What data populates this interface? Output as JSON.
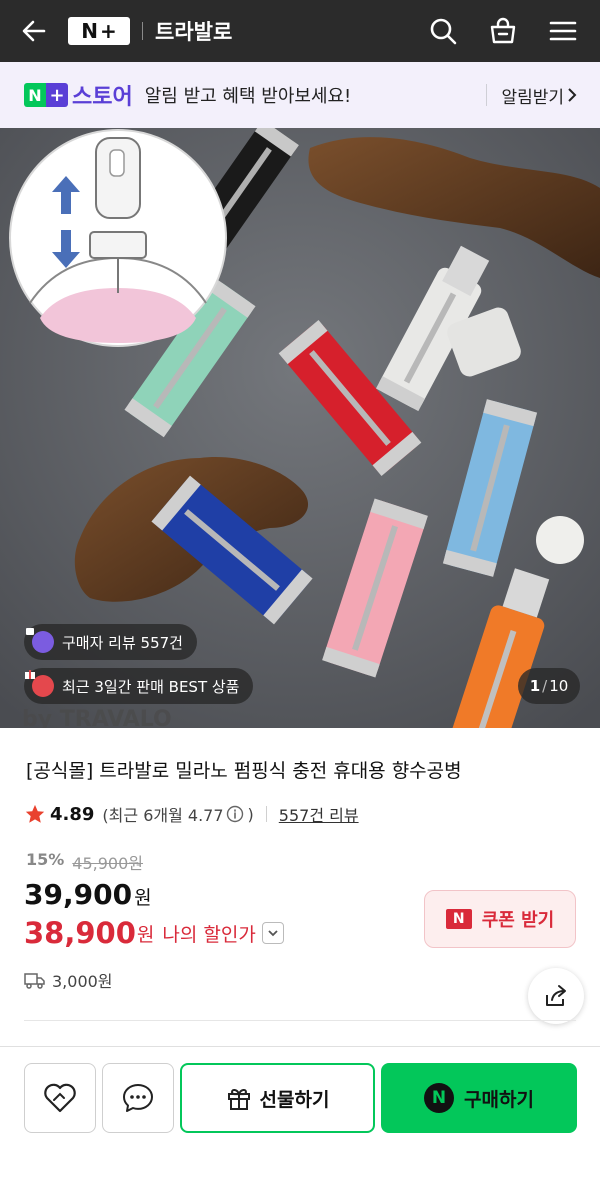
{
  "header": {
    "logo_n": "N",
    "logo_plus": "+",
    "brand": "트라발로",
    "icons": [
      "back-arrow-icon",
      "search-icon",
      "shopping-bag-icon",
      "menu-icon"
    ]
  },
  "banner": {
    "store": "스토어",
    "message": "알림 받고 혜택 받아보세요!",
    "subscribe": "알림받기"
  },
  "gallery": {
    "chip_review": "구매자 리뷰 557건",
    "chip_best": "최근 3일간 판매 BEST 상품",
    "current": "1",
    "total": "10",
    "watermark": "by TRAVALO"
  },
  "product": {
    "title": "[공식몰] 트라발로 밀라노 펌핑식 충전 휴대용 향수공병",
    "rating": "4.89",
    "recent_rating": "(최근 6개월 4.77",
    "recent_close": ")",
    "reviews": "557건 리뷰",
    "discount_pct": "15%",
    "original_price": "45,900원",
    "price": "39,900",
    "price_unit": "원",
    "my_price": "38,900",
    "my_price_unit": "원",
    "my_price_label": "나의 할인가",
    "coupon_badge": "N",
    "coupon_label": "쿠폰 받기",
    "shipping": "3,000원"
  },
  "actions": {
    "gift": "선물하기",
    "buy_badge": "N",
    "buy": "구매하기"
  },
  "colors": {
    "naver_green": "#03c75a",
    "accent_red": "#d92a3a",
    "store_purple": "#5a3fd6",
    "header_bg": "#2b2b2b"
  }
}
